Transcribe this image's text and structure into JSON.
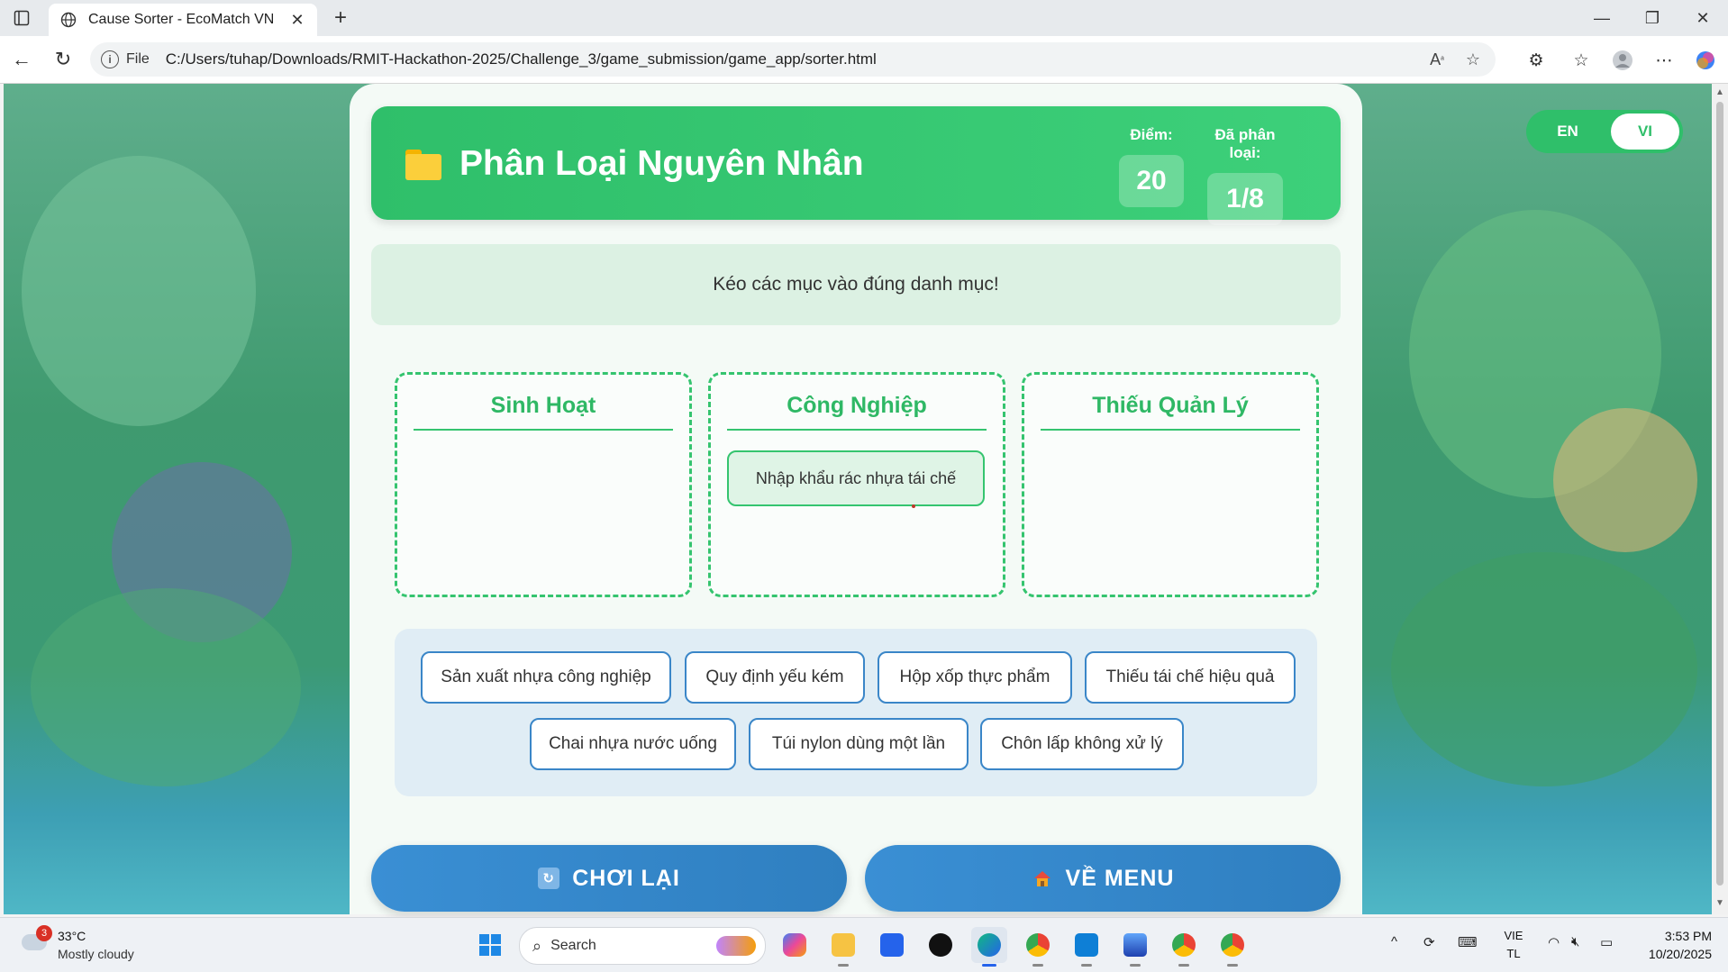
{
  "browser": {
    "tab_title": "Cause Sorter - EcoMatch VN",
    "scheme_label": "File",
    "url": "C:/Users/tuhap/Downloads/RMIT-Hackathon-2025/Challenge_3/game_submission/game_app/sorter.html"
  },
  "game": {
    "title": "Phân Loại Nguyên Nhân",
    "score_label": "Điểm:",
    "score_value": "20",
    "sorted_label": "Đã phân loại:",
    "sorted_value": "1/8",
    "instruction": "Kéo các mục vào đúng danh mục!",
    "categories": [
      {
        "title": "Sinh Hoạt",
        "items": []
      },
      {
        "title": "Công Nghiệp",
        "items": [
          "Nhập khẩu rác nhựa tái chế"
        ]
      },
      {
        "title": "Thiếu Quản Lý",
        "items": []
      }
    ],
    "pool_items": [
      "Sản xuất nhựa công nghiệp",
      "Quy định yếu kém",
      "Hộp xốp thực phẩm",
      "Thiếu tái chế hiệu quả",
      "Chai nhựa nước uống",
      "Túi nylon dùng một lần",
      "Chôn lấp không xử lý"
    ],
    "replay_label": "CHƠI LẠI",
    "menu_label": "VỀ MENU",
    "lang_en": "EN",
    "lang_vi": "VI",
    "lang_active": "VI"
  },
  "taskbar": {
    "weather_temp": "33°C",
    "weather_cond": "Mostly cloudy",
    "weather_badge": "3",
    "search_placeholder": "Search",
    "input_lang_1": "VIE",
    "input_lang_2": "TL",
    "time": "3:53 PM",
    "date": "10/20/2025"
  },
  "colors": {
    "header_green": "#2fbf6a",
    "button_blue": "#3a8fd4",
    "chip_border": "#3a86c8"
  }
}
